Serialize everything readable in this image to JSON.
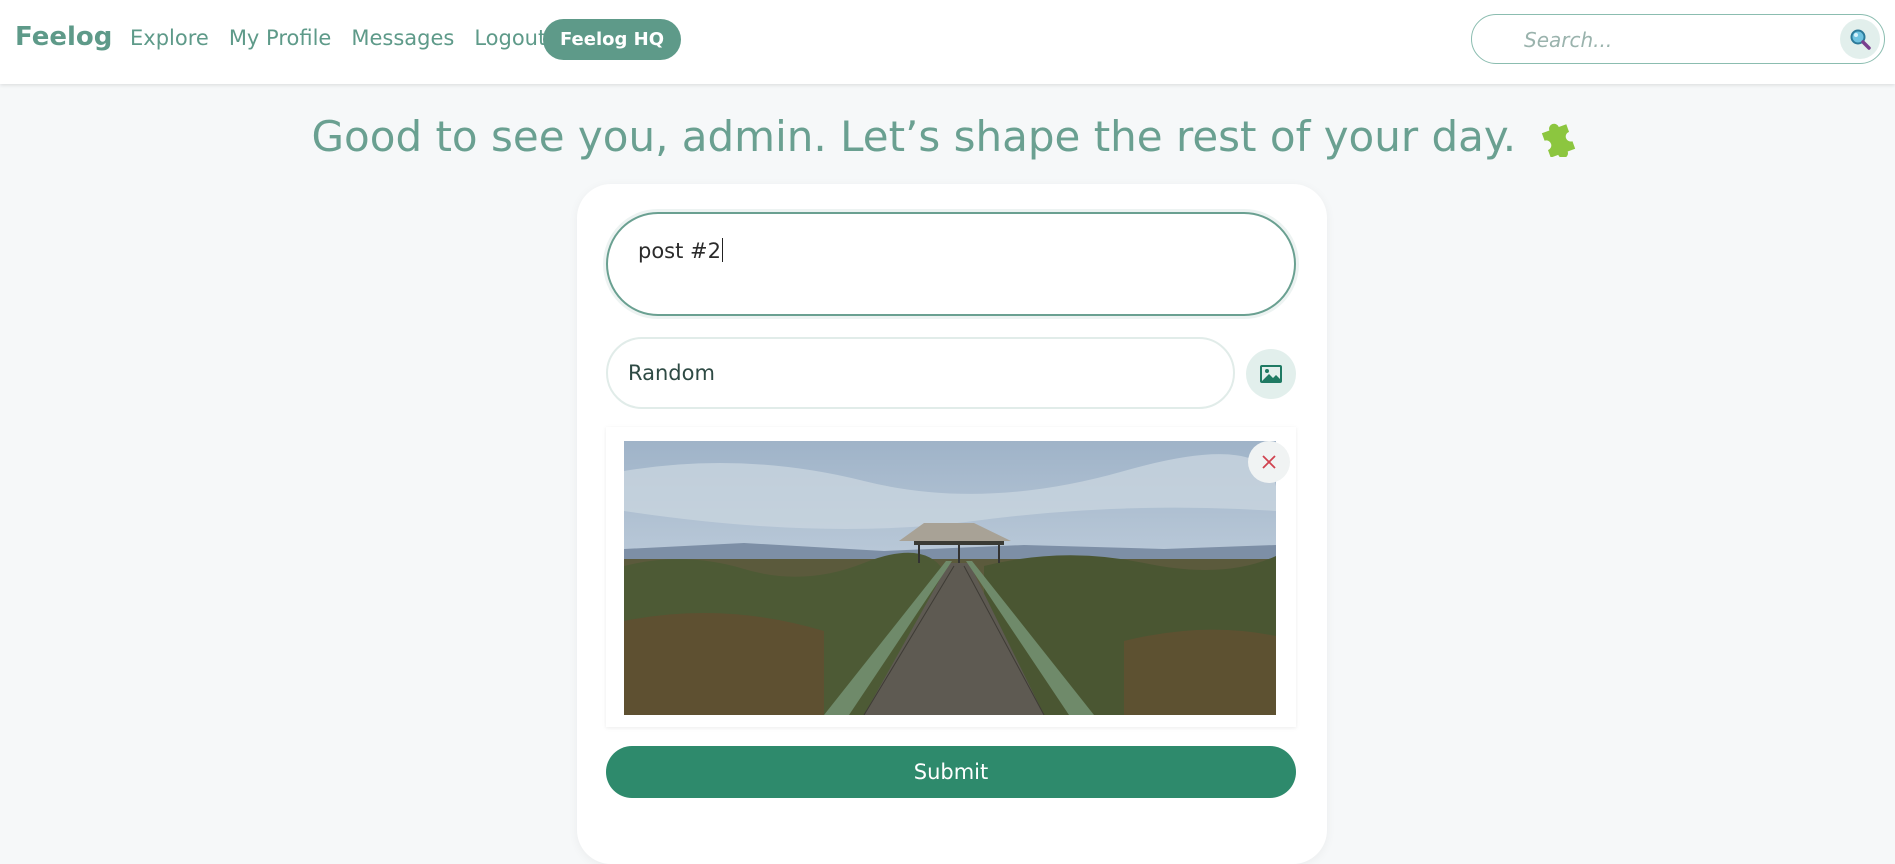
{
  "nav": {
    "brand": "Feelog",
    "links": [
      "Explore",
      "My Profile",
      "Messages",
      "Logout"
    ],
    "hq_button": "Feelog HQ",
    "search_placeholder": "Search..."
  },
  "greeting": "Good to see you, admin. Let’s shape the rest of your day.",
  "form": {
    "post_value": "post #2",
    "category_value": "Random",
    "submit_label": "Submit"
  },
  "icons": {
    "search": "search-icon",
    "image": "image-icon",
    "remove": "close-icon",
    "greeting": "puzzle-icon"
  },
  "colors": {
    "brand": "#5e9a89",
    "submit": "#2e8a6c",
    "remove": "#d0424f"
  }
}
